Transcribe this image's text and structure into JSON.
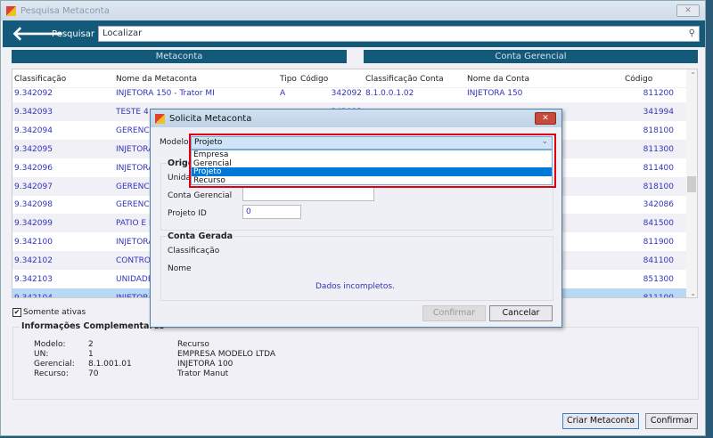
{
  "window": {
    "title": "Pesquisa Metaconta"
  },
  "header": {
    "search_label": "Pesquisar",
    "search_placeholder": "Localizar"
  },
  "sections": {
    "left": "Metaconta",
    "right": "Conta Gerencial"
  },
  "table": {
    "columns": [
      "Classificação",
      "Nome da Metaconta",
      "Tipo",
      "Código",
      "Classificação Conta",
      "Nome da Conta",
      "Código"
    ],
    "rows": [
      [
        "9.342092",
        "INJETORA 150 - Trator MI",
        "A",
        "342092",
        "8.1.0.0.1.02",
        "INJETORA 150",
        "811200"
      ],
      [
        "9.342093",
        "TESTE 4",
        "",
        "342093",
        "",
        "",
        "341994"
      ],
      [
        "9.342094",
        "GERENCIA",
        "",
        "",
        "",
        "",
        "818100"
      ],
      [
        "9.342095",
        "INJETORA",
        "",
        "",
        "",
        "",
        "811300"
      ],
      [
        "9.342096",
        "INJETORA",
        "",
        "",
        "",
        "",
        "811400"
      ],
      [
        "9.342097",
        "GERENCIA",
        "",
        "",
        "",
        "",
        "818100"
      ],
      [
        "9.342098",
        "GERENCIA",
        "",
        "",
        "",
        "",
        "342086"
      ],
      [
        "9.342099",
        "PATIO E R",
        "",
        "",
        "",
        "",
        "841500"
      ],
      [
        "9.342100",
        "INJETORA",
        "",
        "",
        "",
        "",
        "811900"
      ],
      [
        "9.342102",
        "CONTROLA",
        "",
        "",
        "",
        "",
        "841100"
      ],
      [
        "9.342103",
        "UNIDADE (",
        "",
        "",
        "",
        "",
        "851300"
      ],
      [
        "9.342104",
        "INJETORA",
        "",
        "",
        "",
        "",
        "811100"
      ]
    ],
    "selected_row": 11
  },
  "filter": {
    "only_active_label": "Somente ativas",
    "only_active_checked": true
  },
  "info": {
    "title": "Informações Complementares",
    "labels": [
      "Modelo:",
      "UN:",
      "Gerencial:",
      "Recurso:"
    ],
    "values": [
      "2",
      "1",
      "8.1.001.01",
      "70"
    ],
    "descriptions": [
      "Recurso",
      "EMPRESA MODELO LTDA",
      "INJETORA 100",
      "Trator Manut"
    ]
  },
  "buttons": {
    "create": "Criar Metaconta",
    "confirm": "Confirmar"
  },
  "dialog": {
    "title": "Solicita Metaconta",
    "model_label": "Modelo",
    "model_value": "Projeto",
    "model_options": [
      "Empresa",
      "Gerencial",
      "Projeto",
      "Recurso"
    ],
    "origin_title": "Origem",
    "unit_label": "Unidade",
    "account_label": "Conta Gerencial",
    "account_value": "",
    "project_label": "Projeto ID",
    "project_value": "0",
    "generated_title": "Conta Gerada",
    "class_label": "Classificação",
    "name_label": "Nome",
    "status": "Dados incompletos.",
    "confirm": "Confirmar",
    "cancel": "Cancelar"
  },
  "colors": {
    "header": "#135a7a",
    "selected_row": "#b8d8f6",
    "highlight_box": "#e00010",
    "link_text": "#3333bb"
  }
}
